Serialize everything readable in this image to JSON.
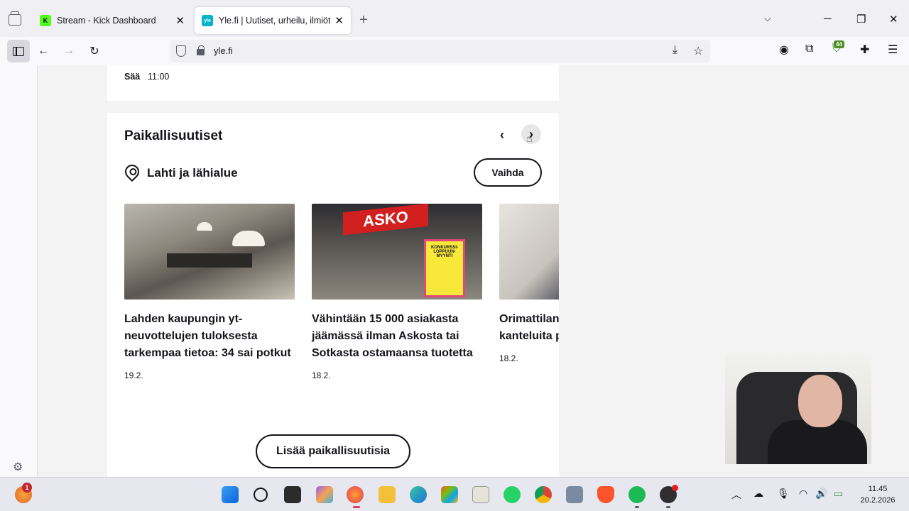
{
  "browser": {
    "tabs": [
      {
        "label": "Stream - Kick Dashboard",
        "favicon": "K",
        "active": false
      },
      {
        "label": "Yle.fi | Uutiset, urheilu, ilmiöt",
        "favicon": "yle",
        "active": true
      }
    ],
    "url": "yle.fi",
    "extension_badge": "44"
  },
  "page": {
    "weather": {
      "label": "Sää",
      "time": "11:00"
    },
    "local_news": {
      "title": "Paikallisuutiset",
      "location": "Lahti ja lähialue",
      "change_label": "Vaihda",
      "articles": [
        {
          "headline": "Lahden kaupungin yt-neuvottelujen tuloksesta tarkempaa tietoa: 34 sai potkut",
          "date": "19.2."
        },
        {
          "headline": "Vähintään 15 000 asiakasta jäämässä ilman Askosta tai Sotkasta ostamaansa tuotetta",
          "date": "18.2."
        },
        {
          "headline": "Orimattilan johtajan va kanteluita petettyjä l",
          "date": "18.2."
        }
      ],
      "image_text": {
        "sign": "ASKO",
        "poster": "KONKURSSI-LOPPUUN-MYYNTI"
      },
      "more_label": "Lisää paikallisuutisia"
    }
  },
  "taskbar": {
    "notification_count": "1",
    "time": "11.45",
    "date": "20.2.2026"
  },
  "colors": {
    "kick_green": "#53fc18",
    "yle_cyan": "#00b4c8",
    "asko_red": "#d21f1f"
  }
}
